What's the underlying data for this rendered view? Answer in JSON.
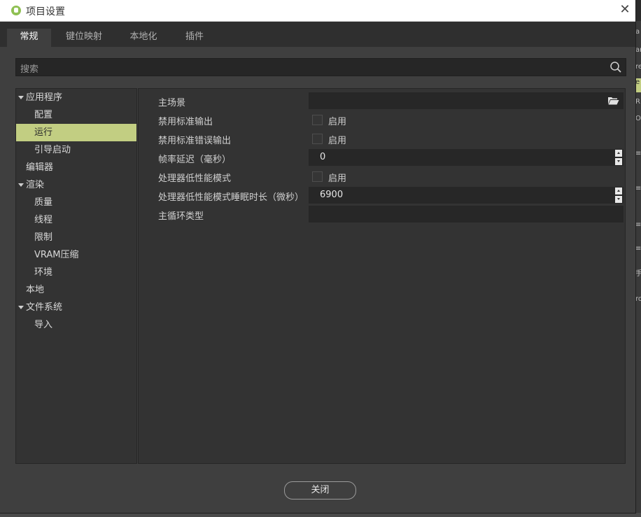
{
  "window": {
    "title": "项目设置"
  },
  "tabs": [
    {
      "label": "常规"
    },
    {
      "label": "键位映射"
    },
    {
      "label": "本地化"
    },
    {
      "label": "插件"
    }
  ],
  "search": {
    "placeholder": "搜索"
  },
  "tree": [
    {
      "label": "应用程序",
      "expanded": true
    },
    {
      "label": "配置"
    },
    {
      "label": "运行",
      "selected": true
    },
    {
      "label": "引导启动"
    },
    {
      "label": "编辑器"
    },
    {
      "label": "渲染",
      "expanded": true
    },
    {
      "label": "质量"
    },
    {
      "label": "线程"
    },
    {
      "label": "限制"
    },
    {
      "label": "VRAM压缩"
    },
    {
      "label": "环境"
    },
    {
      "label": "本地"
    },
    {
      "label": "文件系统",
      "expanded": true
    },
    {
      "label": "导入"
    }
  ],
  "properties": [
    {
      "label": "主场景",
      "type": "file",
      "value": ""
    },
    {
      "label": "禁用标准输出",
      "type": "checkbox",
      "checked": false,
      "check_label": "启用"
    },
    {
      "label": "禁用标准错误输出",
      "type": "checkbox",
      "checked": false,
      "check_label": "启用"
    },
    {
      "label": "帧率延迟（毫秒）",
      "type": "number",
      "value": "0"
    },
    {
      "label": "处理器低性能模式",
      "type": "checkbox",
      "checked": false,
      "check_label": "启用"
    },
    {
      "label": "处理器低性能模式睡眠时长（微秒）",
      "type": "number",
      "value": "6900"
    },
    {
      "label": "主循环类型",
      "type": "text",
      "value": ""
    }
  ],
  "footer": {
    "close_label": "关闭"
  },
  "background_snippets": [
    "a",
    "ar",
    "re",
    "e",
    "R",
    "O",
    "≡",
    "≡",
    "≡",
    "≡",
    "手",
    "ro"
  ],
  "colors": {
    "accent": "#c2ce82",
    "panel": "#333333",
    "field": "#272727"
  }
}
